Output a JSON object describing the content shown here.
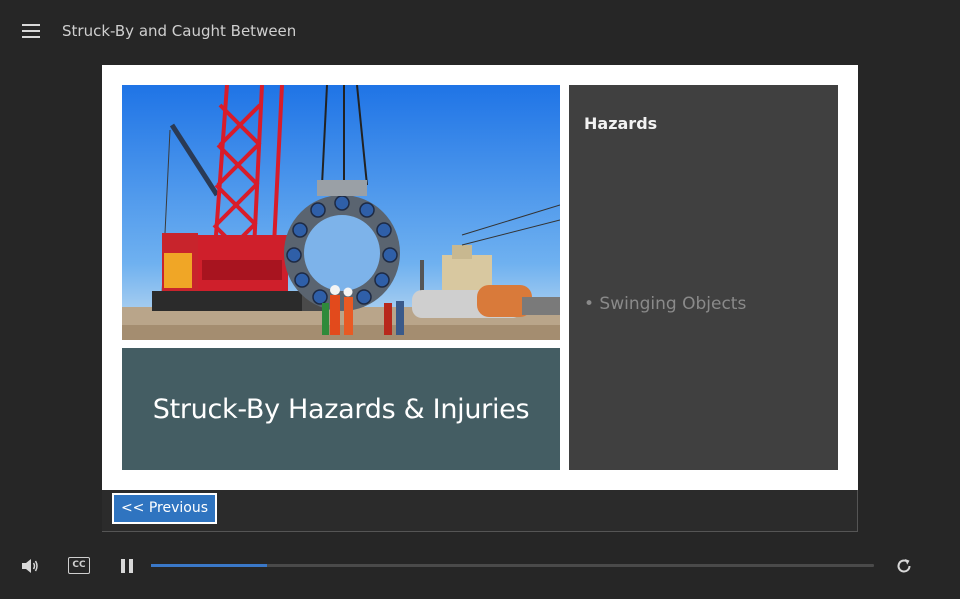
{
  "header": {
    "course_title": "Struck-By and Caught Between",
    "menu_icon": "hamburger-menu-icon"
  },
  "slide": {
    "photo_subject": "crane-construction-site-photo",
    "title": "Struck-By Hazards & Injuries",
    "side_panel": {
      "heading": "Hazards",
      "items": [
        "• Swinging Objects"
      ]
    }
  },
  "navigation": {
    "previous_label": "<< Previous"
  },
  "player": {
    "volume_icon": "volume-icon",
    "cc_label": "CC",
    "pause_icon": "pause-icon",
    "replay_icon": "replay-icon",
    "progress_fraction": 0.16
  },
  "colors": {
    "background": "#262626",
    "title_box": "#445d63",
    "side_panel": "#404040",
    "button": "#2f74c0",
    "progress": "#3a78c8"
  }
}
